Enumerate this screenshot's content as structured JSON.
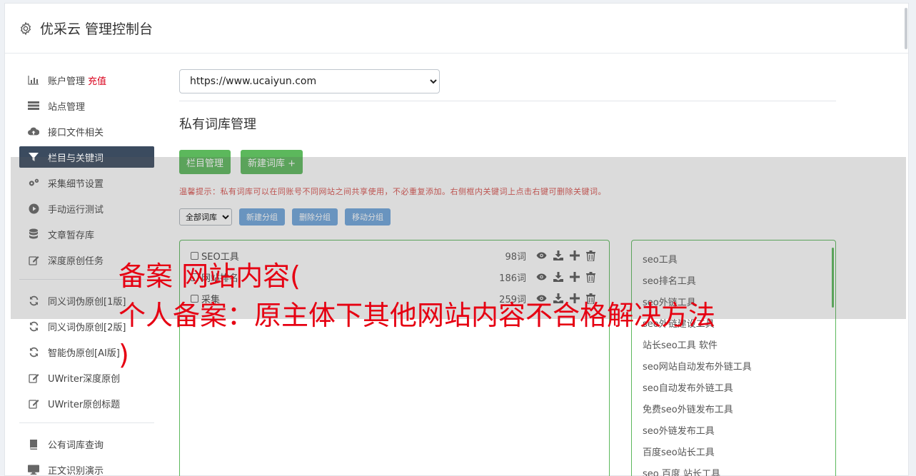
{
  "header": {
    "title": "优采云 管理控制台",
    "icon": "gear-icon"
  },
  "sidebar": {
    "groups": [
      [
        {
          "label": "账户管理",
          "badge": "充值",
          "icon": "bar-chart-icon"
        },
        {
          "label": "站点管理",
          "icon": "server-icon"
        },
        {
          "label": "接口文件相关",
          "icon": "cloud-upload-icon"
        },
        {
          "label": "栏目与关键词",
          "icon": "filter-icon",
          "active": true
        },
        {
          "label": "采集细节设置",
          "icon": "cogs-icon"
        },
        {
          "label": "手动运行测试",
          "icon": "play-circle-icon"
        },
        {
          "label": "文章暂存库",
          "icon": "database-icon"
        },
        {
          "label": "深度原创任务",
          "icon": "edit-icon"
        }
      ],
      [
        {
          "label": "同义词伪原创[1版]",
          "icon": "refresh-icon"
        },
        {
          "label": "同义词伪原创[2版]",
          "icon": "refresh-icon"
        },
        {
          "label": "智能伪原创[AI版]",
          "icon": "refresh-icon"
        },
        {
          "label": "UWriter深度原创",
          "icon": "edit-icon"
        },
        {
          "label": "UWriter原创标题",
          "icon": "edit-icon"
        }
      ],
      [
        {
          "label": "公有词库查询",
          "icon": "book-icon"
        },
        {
          "label": "正文识别演示",
          "icon": "monitor-icon"
        }
      ]
    ]
  },
  "main": {
    "site_select": "https://www.ucaiyun.com",
    "section_title": "私有词库管理",
    "buttons": {
      "column_manage": "栏目管理",
      "new_library": "新建词库 +"
    },
    "tip": "温馨提示：私有词库可以在同账号不同网站之间共享使用，不必重复添加。右侧框内关键词上点击右键可删除关键词。",
    "filter_select": "全部词库",
    "group_buttons": {
      "new_group": "新建分组",
      "delete_group": "删除分组",
      "move_group": "移动分组"
    },
    "libraries": [
      {
        "name": "SEO工具",
        "count": "98词"
      },
      {
        "name": "网站排名",
        "count": "186词"
      },
      {
        "name": "采集",
        "count": "259词"
      }
    ],
    "keywords": [
      "seo工具",
      "seo排名工具",
      "seo外链工具",
      "seo外链建设工具",
      "站长seo工具 软件",
      "seo网站自动发布外链工具",
      "seo自动发布外链工具",
      "免费seo外链发布工具",
      "seo外链发布工具",
      "百度seo站长工具",
      "seo 百度 站长工具"
    ]
  },
  "overlay": {
    "line1": "备案 网站内容(",
    "line2": "个人备案：原主体下其他网站内容不合格解决方法",
    "line3": ")"
  },
  "colors": {
    "active_nav": "#3b4b5f",
    "green": "#5cb85c",
    "blue": "#6ea5db",
    "red": "#d9001b",
    "overlay_red": "#e60012"
  }
}
